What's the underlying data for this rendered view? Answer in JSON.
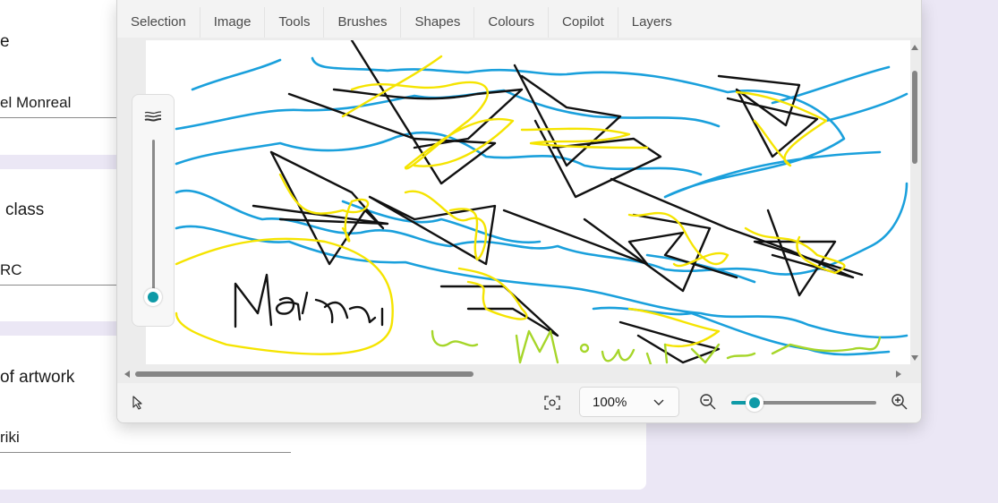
{
  "form": {
    "field1_label": "e",
    "field1_value": "el Monreal",
    "field2_label": "class",
    "field2_value": "RC",
    "field3_label": "of artwork",
    "field3_value": "riki"
  },
  "paint": {
    "menu": [
      "Selection",
      "Image",
      "Tools",
      "Brushes",
      "Shapes",
      "Colours",
      "Copilot",
      "Layers"
    ],
    "zoom_value": "100%",
    "canvas_text_handwritten": "Māori",
    "canvas_text_green": "Monreal",
    "colors": {
      "accent": "#0e9aa7",
      "blue_stroke": "#1aa0dc",
      "yellow_stroke": "#f5e400",
      "green_stroke": "#a6d62a",
      "black_stroke": "#111111"
    }
  },
  "icons": {
    "brush_size": "brush-size-icon",
    "pointer": "pointer-icon",
    "fit": "fit-to-window-icon",
    "chevron": "chevron-down-icon",
    "zoom_out": "zoom-out-icon",
    "zoom_in": "zoom-in-icon"
  },
  "state": {
    "zoom_slider_fraction": 0.17,
    "brush_size_fraction": 0.0
  }
}
